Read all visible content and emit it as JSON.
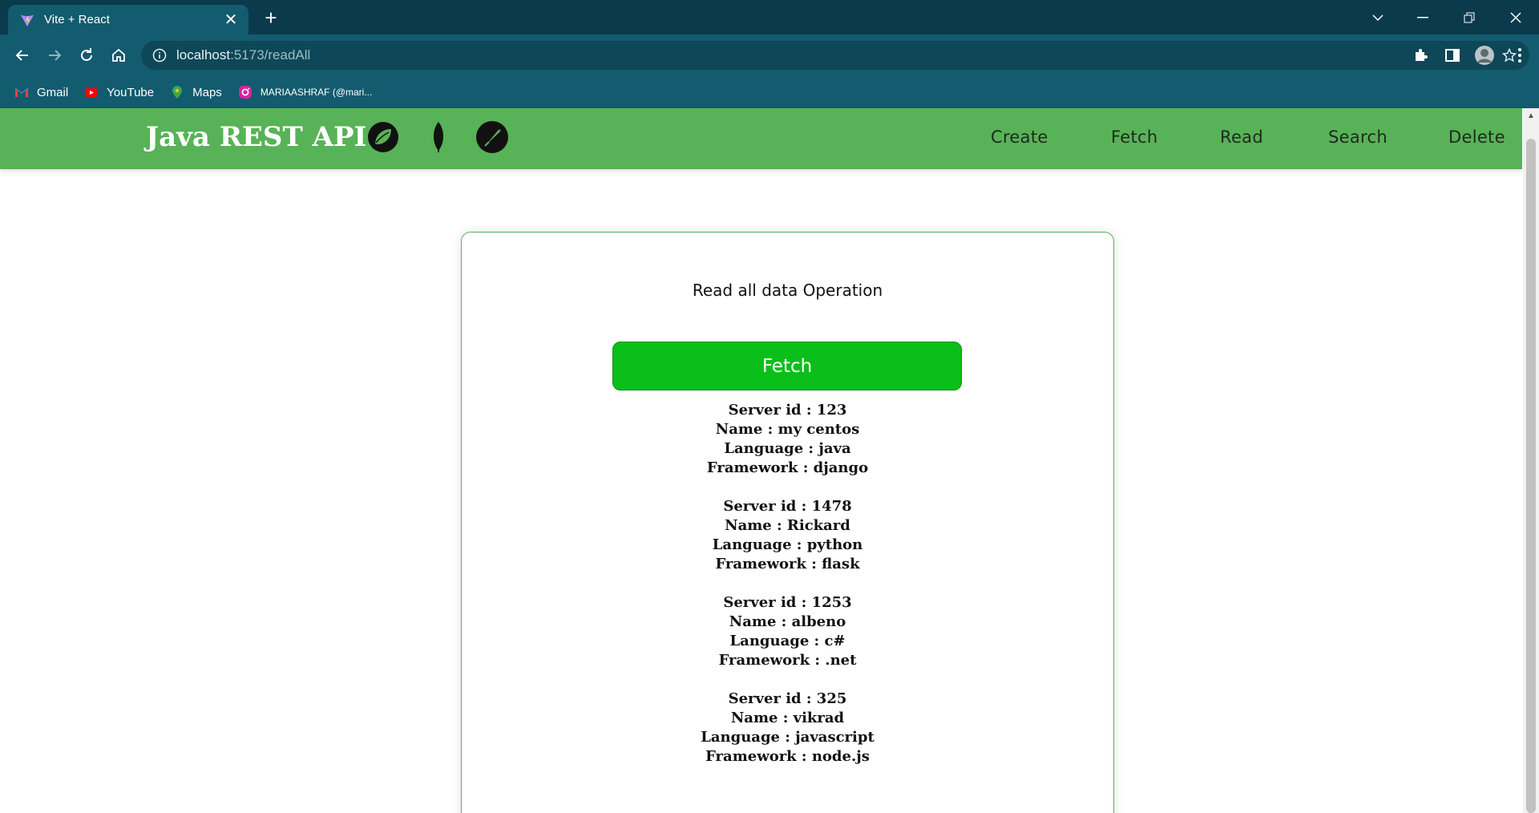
{
  "browser": {
    "tab_title": "Vite + React",
    "url_host": "localhost",
    "url_path": ":5173/readAll",
    "bookmarks": [
      {
        "label": "Gmail",
        "icon": "gmail-icon"
      },
      {
        "label": "YouTube",
        "icon": "youtube-icon"
      },
      {
        "label": "Maps",
        "icon": "maps-icon"
      },
      {
        "label": "MARIAASHRAF (@mari...",
        "icon": "instagram-icon"
      }
    ]
  },
  "header": {
    "brand": "Java REST API",
    "logos": [
      "spring-icon",
      "mongodb-leaf-icon",
      "feather-pen-icon"
    ],
    "nav": [
      "Create",
      "Fetch",
      "Read",
      "Search",
      "Delete"
    ]
  },
  "main": {
    "title": "Read all data Operation",
    "fetch_label": "Fetch",
    "records": [
      {
        "id": "Server id : 123",
        "name": "Name : my centos",
        "language": "Language : java",
        "framework": "Framework : django"
      },
      {
        "id": "Server id : 1478",
        "name": "Name : Rickard",
        "language": "Language : python",
        "framework": "Framework : flask"
      },
      {
        "id": "Server id : 1253",
        "name": "Name : albeno",
        "language": "Language : c#",
        "framework": "Framework : .net"
      },
      {
        "id": "Server id : 325",
        "name": "Name : vikrad",
        "language": "Language : javascript",
        "framework": "Framework : node.js"
      }
    ]
  },
  "colors": {
    "navbar": "#58b257",
    "button": "#0bbf1a",
    "chrome": "#135b6e"
  }
}
